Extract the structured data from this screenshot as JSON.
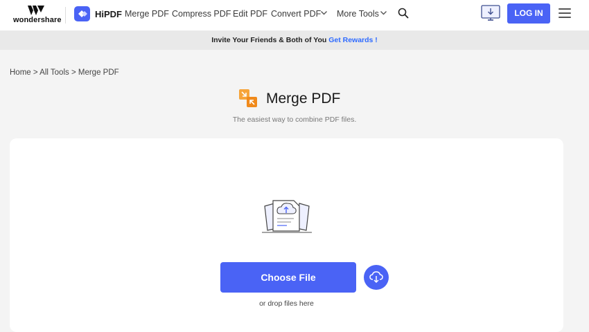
{
  "header": {
    "brand": "wondershare",
    "product": "HiPDF",
    "nav": [
      {
        "label": "Merge PDF"
      },
      {
        "label": "Compress PDF"
      },
      {
        "label": "Edit PDF"
      },
      {
        "label": "Convert PDF"
      },
      {
        "label": "More Tools"
      }
    ],
    "login_label": "LOG IN",
    "icons": {
      "search": "search-icon",
      "desktop": "desktop-download-icon",
      "menu": "hamburger-menu-icon"
    }
  },
  "promo": {
    "text": "Invite Your Friends & Both of You ",
    "link": "Get Rewards !"
  },
  "breadcrumb": "Home > All Tools > Merge PDF",
  "main": {
    "title": "Merge PDF",
    "subtitle": "The easiest way to combine PDF files.",
    "choose_label": "Choose File",
    "drop_text": "or drop files here"
  },
  "colors": {
    "accent": "#4a63f5",
    "link": "#2f6bff",
    "tool_icon": "#f39a2b"
  }
}
